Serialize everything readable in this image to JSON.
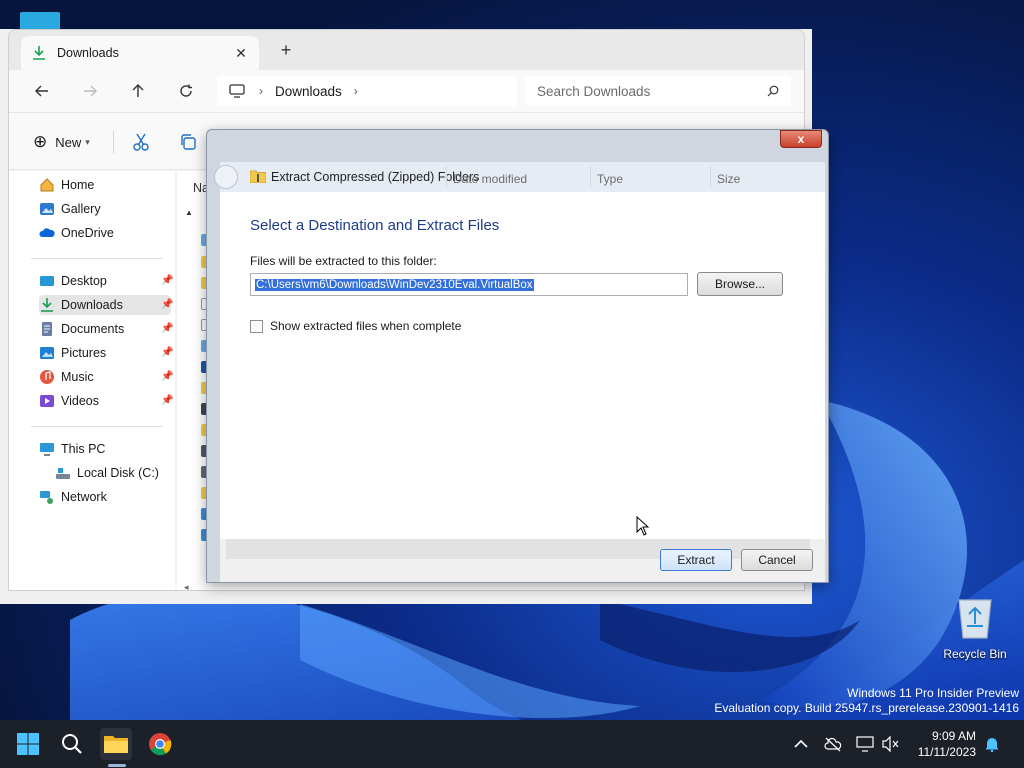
{
  "explorer": {
    "tab_title": "Downloads",
    "new_tab_symbol": "+",
    "close_symbol": "✕",
    "breadcrumb": [
      "Downloads"
    ],
    "search_placeholder": "Search Downloads",
    "new_label": "New",
    "column_partial": "Na",
    "nav_items": [
      {
        "label": "Home",
        "icon": "home-icon"
      },
      {
        "label": "Gallery",
        "icon": "gallery-icon"
      },
      {
        "label": "OneDrive",
        "icon": "onedrive-icon"
      },
      {
        "label": "Desktop",
        "icon": "desktop-icon",
        "pinned": true
      },
      {
        "label": "Downloads",
        "icon": "download-icon",
        "pinned": true,
        "selected": true
      },
      {
        "label": "Documents",
        "icon": "documents-icon",
        "pinned": true
      },
      {
        "label": "Pictures",
        "icon": "pictures-icon",
        "pinned": true
      },
      {
        "label": "Music",
        "icon": "music-icon",
        "pinned": true
      },
      {
        "label": "Videos",
        "icon": "videos-icon",
        "pinned": true
      },
      {
        "label": "This PC",
        "icon": "this-pc-icon"
      },
      {
        "label": "Local Disk (C:)",
        "icon": "local-disk-icon"
      },
      {
        "label": "Network",
        "icon": "network-icon"
      }
    ]
  },
  "dialog": {
    "title": "Extract Compressed (Zipped) Folders",
    "ghost_columns": [
      "Date modified",
      "Type",
      "Size"
    ],
    "heading": "Select a Destination and Extract Files",
    "folder_label": "Files will be extracted to this folder:",
    "path_value": "C:\\Users\\vm6\\Downloads\\WinDev2310Eval.VirtualBox",
    "browse_label": "Browse...",
    "show_files_label": "Show extracted files when complete",
    "show_files_checked": false,
    "extract_label": "Extract",
    "cancel_label": "Cancel",
    "close_symbol": "x"
  },
  "desktop": {
    "recycle_bin_label": "Recycle Bin",
    "watermark_line1": "Windows 11 Pro Insider Preview",
    "watermark_line2": "Evaluation copy. Build 25947.rs_prerelease.230901-1416"
  },
  "taskbar": {
    "time": "9:09 AM",
    "date": "11/11/2023"
  },
  "colors": {
    "accent": "#0067c0",
    "dialog_heading": "#1e3b8a",
    "selection": "#3470d8",
    "taskbar": "#1c2029"
  }
}
